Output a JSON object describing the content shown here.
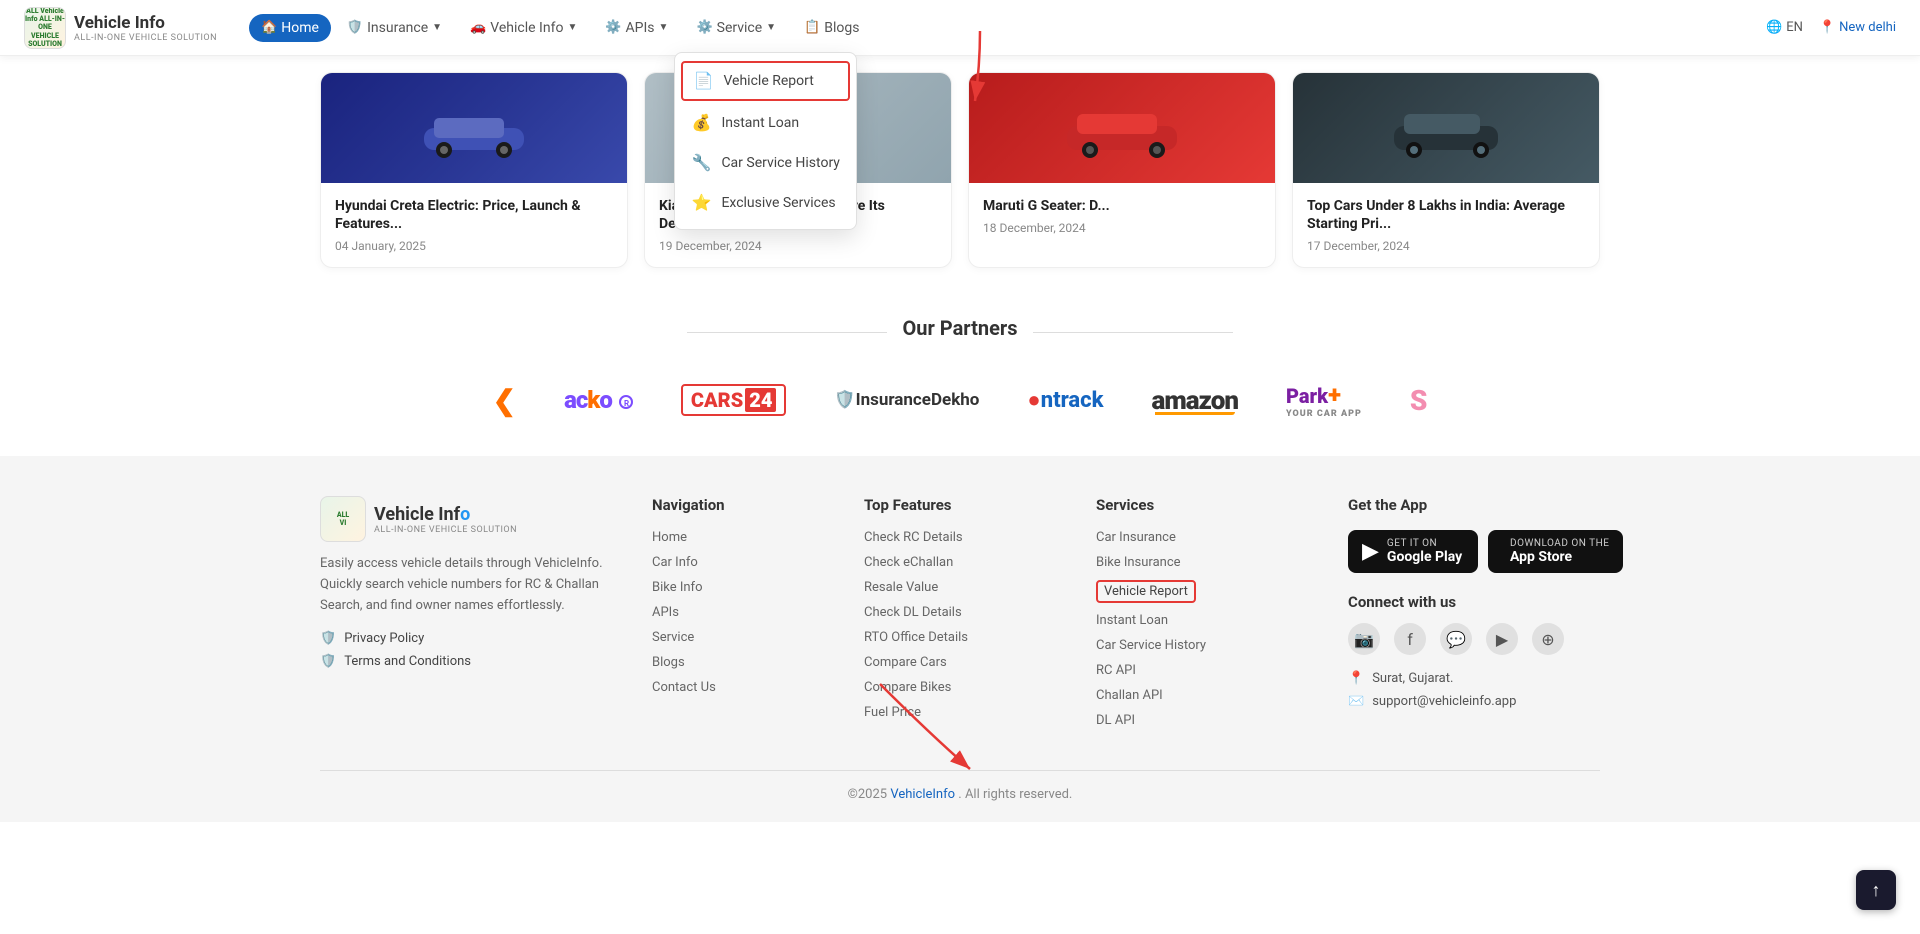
{
  "brand": {
    "name": "Vehicle Info",
    "name_highlight": "o",
    "tagline": "ALL-IN-ONE VEHICLE SOLUTION",
    "logo_text": "ALL Vehicle Info ALL-IN-ONE VEHICLE SOLUTION"
  },
  "navbar": {
    "home_label": "Home",
    "insurance_label": "Insurance",
    "vehicle_info_label": "Vehicle Info",
    "apis_label": "APIs",
    "service_label": "Service",
    "blogs_label": "Blogs",
    "lang_label": "EN",
    "location_label": "New delhi"
  },
  "service_dropdown": {
    "items": [
      {
        "label": "Vehicle Report",
        "highlighted": true
      },
      {
        "label": "Instant Loan",
        "highlighted": false
      },
      {
        "label": "Car Service History",
        "highlighted": false
      },
      {
        "label": "Exclusive Services",
        "highlighted": false
      }
    ]
  },
  "cards": [
    {
      "title": "Hyundai Creta Electric: Price, Launch & Features...",
      "date": "04 January, 2025",
      "color": "card-img-1"
    },
    {
      "title": "Kia Syros: What to Expect Before Its December 19...",
      "date": "19 December, 2024",
      "color": "card-img-2"
    },
    {
      "title": "Maruti G Seater: D...",
      "date": "18 December, 2024",
      "color": "card-img-3"
    },
    {
      "title": "Top Cars Under 8 Lakhs in India: Average Starting Pri...",
      "date": "17 December, 2024",
      "color": "card-img-4"
    }
  ],
  "partners": {
    "section_title": "Our Partners",
    "logos": [
      "acko",
      "cars24",
      "insurancedekho",
      "ontrack",
      "amazon",
      "park+"
    ]
  },
  "footer": {
    "desc": "Easily access vehicle details through VehicleInfo. Quickly search vehicle numbers for RC & Challan Search, and find owner names effortlessly.",
    "privacy_policy": "Privacy Policy",
    "terms": "Terms and Conditions",
    "navigation": {
      "title": "Navigation",
      "items": [
        "Home",
        "Car Info",
        "Bike Info",
        "APIs",
        "Service",
        "Blogs",
        "Contact Us"
      ]
    },
    "top_features": {
      "title": "Top Features",
      "items": [
        "Check RC Details",
        "Check eChallan",
        "Resale Value",
        "Check DL Details",
        "RTO Office Details",
        "Compare Cars",
        "Compare Bikes",
        "Fuel Price"
      ]
    },
    "services": {
      "title": "Services",
      "items": [
        "Car Insurance",
        "Bike Insurance",
        "Vehicle Report",
        "Instant Loan",
        "Car Service History",
        "RC API",
        "Challan API",
        "DL API"
      ]
    },
    "get_app": {
      "title": "Get the App",
      "google_play_small": "GET IT ON",
      "google_play_large": "Google Play",
      "app_store_small": "DOWNLOAD ON THE",
      "app_store_large": "App Store",
      "connect_title": "Connect with us",
      "social": [
        "instagram",
        "facebook",
        "whatsapp",
        "youtube",
        "share"
      ],
      "location": "Surat, Gujarat.",
      "email": "support@vehicleinfo.app"
    }
  },
  "footer_bottom": {
    "copyright": "©2025",
    "brand_link": "VehicleInfo",
    "rights": ". All rights reserved."
  },
  "scroll_top": "↑"
}
